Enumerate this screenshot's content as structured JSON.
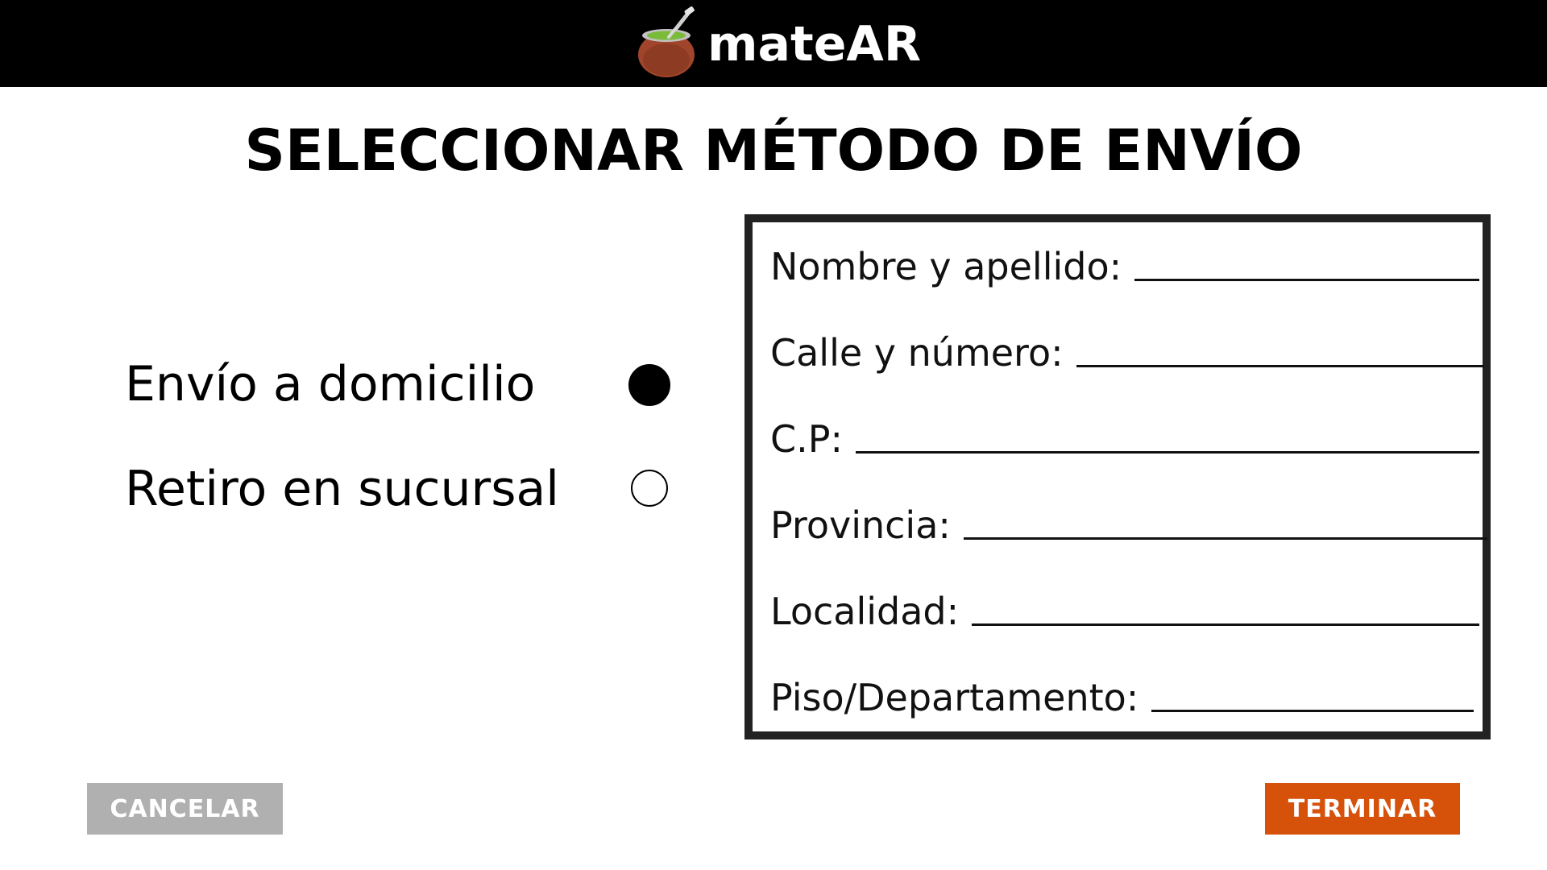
{
  "header": {
    "brand_name": "mateAR",
    "logo_icon": "mate-gourd-icon"
  },
  "page": {
    "title": "SELECCIONAR MÉTODO DE ENVÍO"
  },
  "shipping_options": [
    {
      "label": "Envío a domicilio",
      "selected": true
    },
    {
      "label": "Retiro en sucursal",
      "selected": false
    }
  ],
  "address_form": {
    "fields": [
      {
        "label": "Nombre y apellido:",
        "value": ""
      },
      {
        "label": "Calle y número:",
        "value": ""
      },
      {
        "label": "C.P:",
        "value": ""
      },
      {
        "label": "Provincia:",
        "value": ""
      },
      {
        "label": "Localidad:",
        "value": ""
      },
      {
        "label": "Piso/Departamento:",
        "value": ""
      }
    ]
  },
  "actions": {
    "cancel_label": "CANCELAR",
    "finish_label": "TERMINAR"
  },
  "colors": {
    "header_bg": "#000000",
    "cancel_bg": "#b0b0b0",
    "finish_bg": "#d6510a"
  }
}
